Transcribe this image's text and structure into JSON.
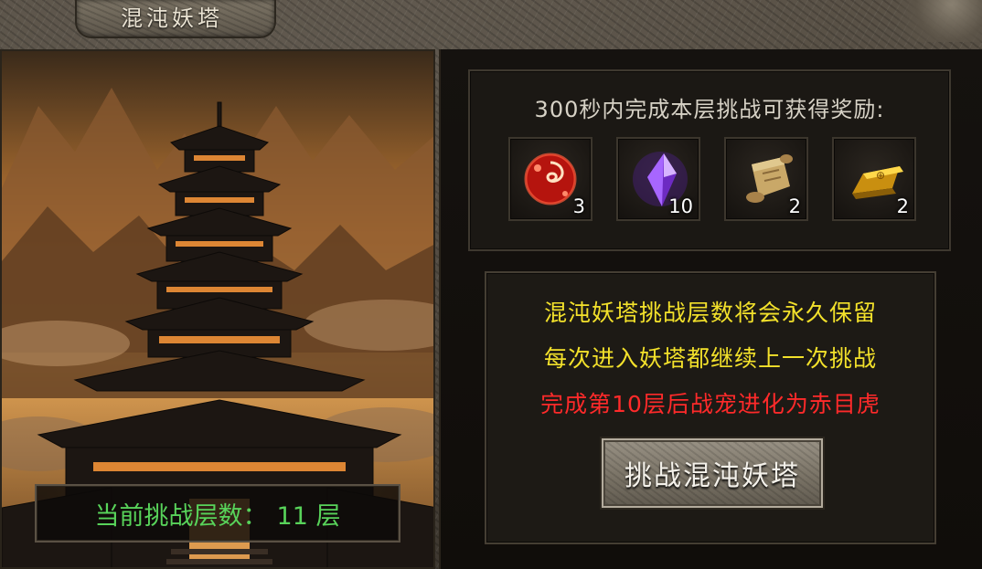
{
  "window": {
    "title": "混沌妖塔"
  },
  "floor": {
    "label": "当前挑战层数：",
    "value": "11 层"
  },
  "rewards": {
    "title": "300秒内完成本层挑战可获得奖励:",
    "items": [
      {
        "icon": "red-orb-icon",
        "count": "3"
      },
      {
        "icon": "purple-crystal-icon",
        "count": "10"
      },
      {
        "icon": "scroll-icon",
        "count": "2"
      },
      {
        "icon": "gold-bar-icon",
        "count": "2"
      }
    ]
  },
  "info": {
    "line1": "混沌妖塔挑战层数将会永久保留",
    "line2": "每次进入妖塔都继续上一次挑战",
    "line3": "完成第10层后战宠进化为赤目虎"
  },
  "button": {
    "label": "挑战混沌妖塔"
  },
  "colors": {
    "yellow": "#f3e12b",
    "red": "#ff2a2a",
    "green": "#58d35a"
  }
}
